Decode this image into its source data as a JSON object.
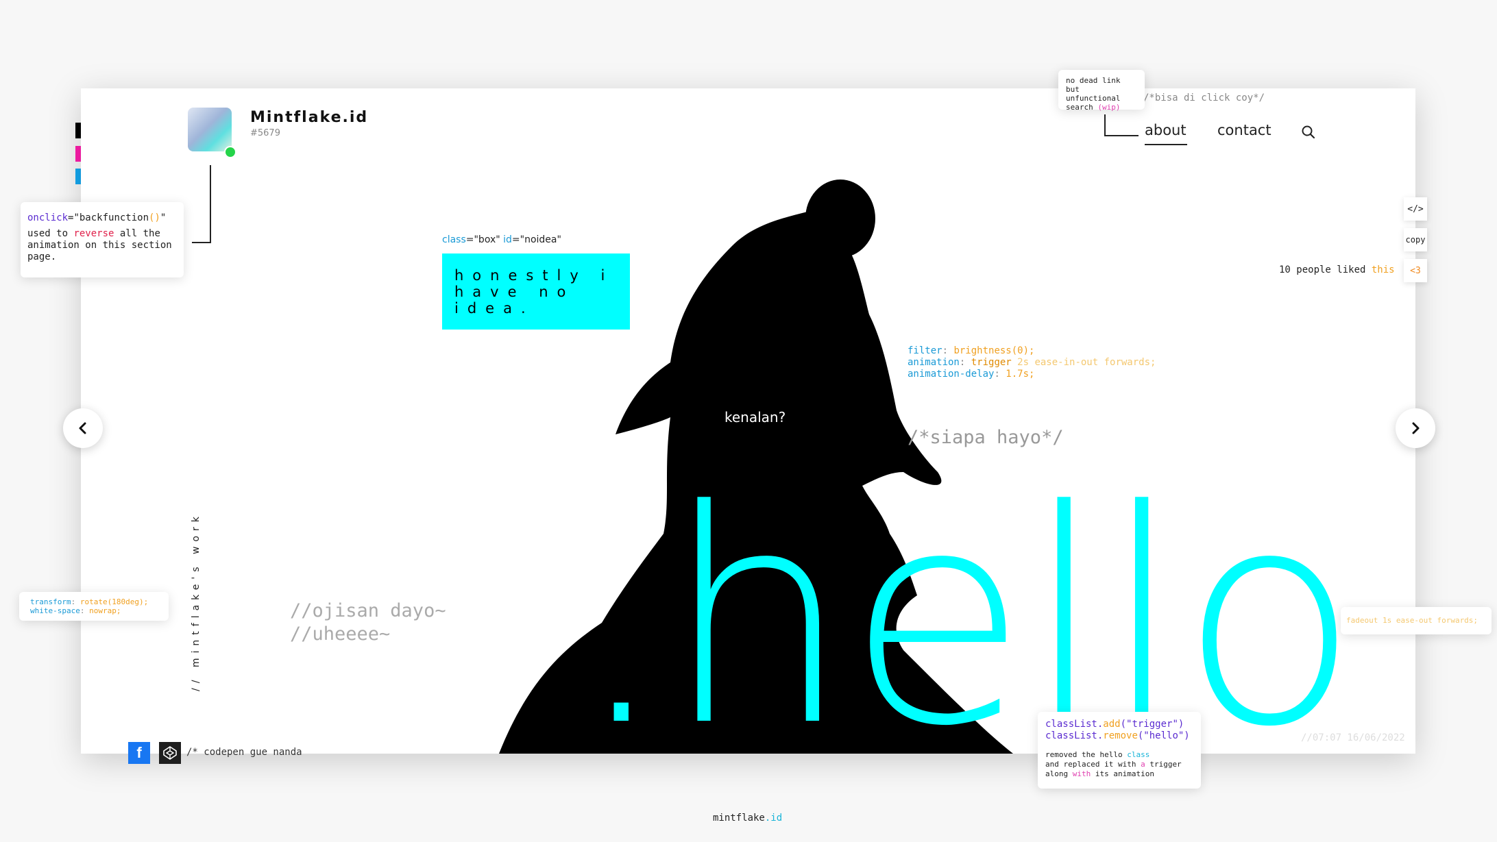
{
  "swatches": {
    "black": "#000000",
    "pink": "#ff1ead",
    "blue": "#14a8f0"
  },
  "accent": "#00ffff",
  "backfunction_tip": {
    "attr": "onclick",
    "eq": "=\"",
    "fn": "backfunction",
    "parens": "()",
    "close": "\"",
    "line1": "used to ",
    "reverse": "reverse",
    "line1b": " all the",
    "line2": "animation on this section",
    "line3": "page."
  },
  "profile": {
    "name": "Mintflake.id",
    "tag": "#5679",
    "status_color": "#25d44a"
  },
  "search_tip": {
    "line1": "no dead link",
    "line2": "but unfunctional",
    "line3": "search ",
    "wip": "(wip)"
  },
  "clickable_comment": "/*bisa di click coy*/",
  "nav": {
    "about": "about",
    "contact": "contact"
  },
  "box_attr": {
    "class_kw": "class",
    "class_val": "=\"box\" ",
    "id_kw": "id",
    "id_val": "=\"noidea\""
  },
  "box_text": "honestly i have no idea.",
  "side_buttons": {
    "code": "</>",
    "copy": "copy",
    "heart": "<3"
  },
  "likes": {
    "text": "10 people liked ",
    "this": "this"
  },
  "css_code": {
    "filter_prop": "filter",
    "filter_val": " brightness(0);",
    "anim_prop": "animation",
    "anim_val1": " trigger",
    "anim_val2": " 2s ease-in-out forwards;",
    "delay_prop": "animation-delay",
    "delay_val": " 1.7s;"
  },
  "kenalan": "kenalan?",
  "siapa": "/*siapa hayo*/",
  "hello": ".hello",
  "vertical_text": "// mintflake's work",
  "ojisan": {
    "line1": "//ojisan dayo~",
    "line2": "//uheeee~"
  },
  "rotate_tip": {
    "prop1": "transform",
    "val1": " rotate(180deg);",
    "prop2": "white-space",
    "val2": " nowrap;"
  },
  "fadeout_tip": "fadeout 1s ease-out forwards;",
  "classlist_tip": {
    "l1a": "classList.",
    "l1b": "add",
    "l1c": "(\"trigger\")",
    "l2a": "classList.",
    "l2b": "remove",
    "l2c": "(\"hello\")",
    "d1a": "removed the hello ",
    "d1b": "class",
    "d2a": "and replaced it with ",
    "d2b": "a",
    "d2c": " trigger",
    "d3a": "along ",
    "d3b": "with",
    "d3c": " its animation"
  },
  "date_watermark": "//07:07 16/06/2022",
  "social": {
    "codepen_comment": "/* codepen gue nanda"
  },
  "footer": {
    "name": "mintflake",
    "tld": ".id"
  }
}
